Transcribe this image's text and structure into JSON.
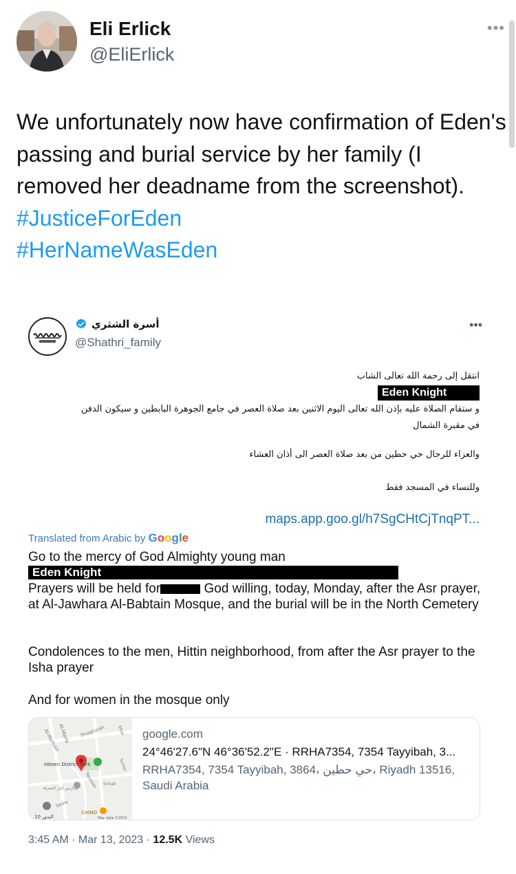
{
  "author": {
    "display_name": "Eli Erlick",
    "handle": "@EliErlick",
    "more": "•••"
  },
  "tweet": {
    "text_plain": "We unfortunately now have confirmation of Eden's passing and burial service by her family (I removed her deadname from the screenshot).",
    "hashtags": [
      "#JusticeForEden",
      "#HerNameWasEden"
    ]
  },
  "embedded_tweet": {
    "display_name": "أسرة الشثري",
    "handle": "@Shathri_family",
    "more": "•••",
    "logo_text": "Shathri family",
    "arabic_lines": [
      "انتقل إلى رحمة الله تعالى الشاب",
      "و ستقام الصلاة عليه بإذن الله تعالى اليوم الاثنين بعد صلاة العصر في جامع الجوهرة البابطين و سيكون الدفن",
      "في مقبرة الشمال",
      "والعزاء للرجال حي حطين من بعد صلاة العصر الى أذان العشاء",
      "وللنساء في المسجد فقط"
    ],
    "redaction_label": "Eden Knight",
    "maps_link": "maps.app.goo.gl/h7SgCHtCjTnqPT...",
    "translated_prefix": "Translated from Arabic by",
    "google_letters": [
      "G",
      "o",
      "o",
      "g",
      "l",
      "e"
    ],
    "translation": {
      "line1": "Go to the mercy of God Almighty young man",
      "redaction_label": "Eden Knight",
      "para1_pre": "Prayers will be held for",
      "para1_post": " God willing, today, Monday, after the Asr prayer, at Al-Jawhara Al-Babtain Mosque, and the burial will be in the North Cemetery",
      "para2": "Condolences to the men, Hittin neighborhood, from after the Asr prayer to the Isha prayer",
      "para3": "And for women in the mosque only"
    },
    "link_card": {
      "domain": "google.com",
      "title": "24°46'27.6\"N 46°36'52.2\"E · RRHA7354, 7354 Tayyibah, 3...",
      "description": "RRHA7354, 7354 Tayyibah, 3864، حي حطين، Riyadh 13516, Saudi Arabia",
      "map_labels": {
        "district": "Hiteen District Park",
        "area1": "Al-Markazi",
        "area2": "Al-Marfa",
        "road": "Shaqrurah",
        "sahar": "Sihar",
        "sumer": "Sumer",
        "simah": "Simah",
        "tayyibah": "Tayyibah",
        "salala": "Salala",
        "chino": "CHINO",
        "num": "10 البدور",
        "credit": "Map data ©2023",
        "school": "مدارس كبار المعرفة"
      }
    },
    "time": "3:45 AM",
    "date": "Mar 13, 2023",
    "views_count": "12.5K",
    "views_label": "Views"
  },
  "colors": {
    "link": "#1d9bf0",
    "verified": "#1d9bf0",
    "pin": "#e53935"
  }
}
